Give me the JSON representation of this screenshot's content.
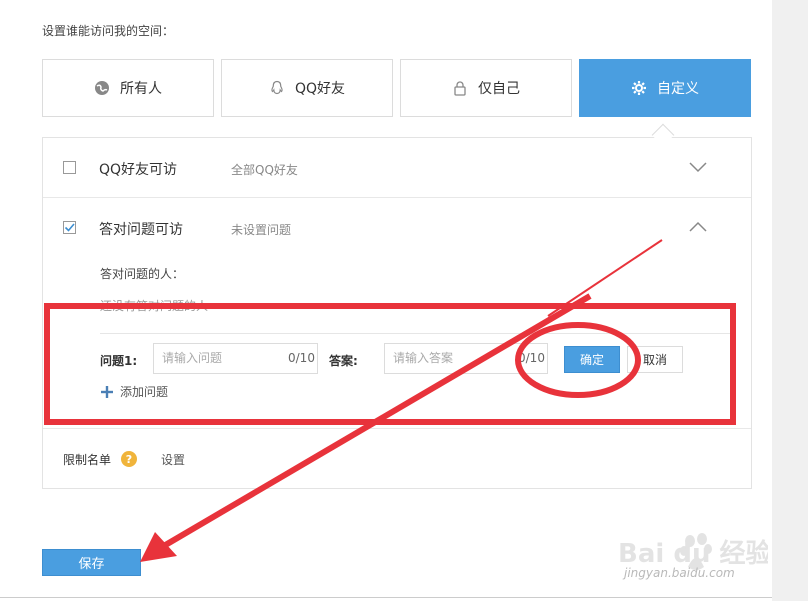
{
  "header": {
    "label": "设置谁能访问我的空间："
  },
  "options": [
    {
      "label": "所有人",
      "icon": "globe-icon"
    },
    {
      "label": "QQ好友",
      "icon": "qq-penguin-icon"
    },
    {
      "label": "仅自己",
      "icon": "lock-icon"
    },
    {
      "label": "自定义",
      "icon": "gear-icon",
      "active": true
    }
  ],
  "rows": {
    "qq_friends": {
      "title": "QQ好友可访",
      "subtitle": "全部QQ好友",
      "checked": false
    },
    "answer_question": {
      "title": "答对问题可访",
      "subtitle": "未设置问题",
      "checked": true,
      "who_label": "答对问题的人：",
      "faded_text": "还没有答对问题的人"
    }
  },
  "question_form": {
    "question_label": "问题1:",
    "question_placeholder": "请输入问题",
    "question_counter": "0/10",
    "answer_label": "答案:",
    "answer_placeholder": "请输入答案",
    "answer_counter": "0/10",
    "confirm_label": "确定",
    "cancel_label": "取消",
    "add_label": "添加问题"
  },
  "limit": {
    "label": "限制名单",
    "help": "?",
    "set_label": "设置"
  },
  "footer": {
    "save_label": "保存"
  },
  "watermark": {
    "brand": "Bai du 经验",
    "url": "jingyan.baidu.com"
  },
  "colors": {
    "accent": "#4a9ee0",
    "annotation": "#e8333b",
    "help": "#f0b43b"
  }
}
